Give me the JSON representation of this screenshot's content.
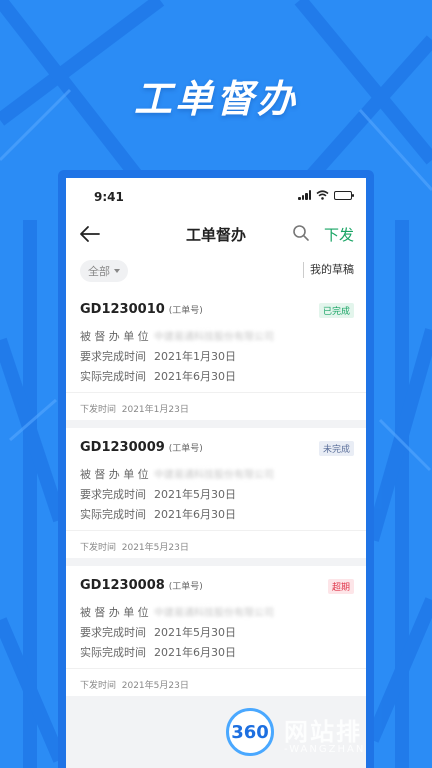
{
  "hero": {
    "title": "工单督办"
  },
  "status_bar": {
    "time": "9:41"
  },
  "nav": {
    "title": "工单督办",
    "action": "下发"
  },
  "filter": {
    "selected": "全部",
    "drafts": "我的草稿"
  },
  "labels": {
    "id_tag": "(工单号)",
    "unit": "被督办单位",
    "required": "要求完成时间",
    "actual": "实际完成时间",
    "issued": "下发时间"
  },
  "orders": [
    {
      "id": "GD1230010",
      "status": "已完成",
      "status_color": "#19a464",
      "unit": "中建易通科技股份有限公司",
      "required": "2021年1月30日",
      "actual": "2021年6月30日",
      "issued": "2021年1月23日"
    },
    {
      "id": "GD1230009",
      "status": "未完成",
      "status_color": "#5b6f9a",
      "unit": "中建易通科技股份有限公司",
      "required": "2021年5月30日",
      "actual": "2021年6月30日",
      "issued": "2021年5月23日"
    },
    {
      "id": "GD1230008",
      "status": "超期",
      "status_color": "#e0354a",
      "unit": "中建易通科技股份有限公司",
      "required": "2021年5月30日",
      "actual": "2021年6月30日",
      "issued": "2021年5月23日"
    }
  ],
  "watermark": {
    "logo": "360",
    "text": "网站排",
    "sub": "-WANGZHAN"
  },
  "colors": {
    "background": "#2b8cf5",
    "accent_green": "#19a464"
  }
}
